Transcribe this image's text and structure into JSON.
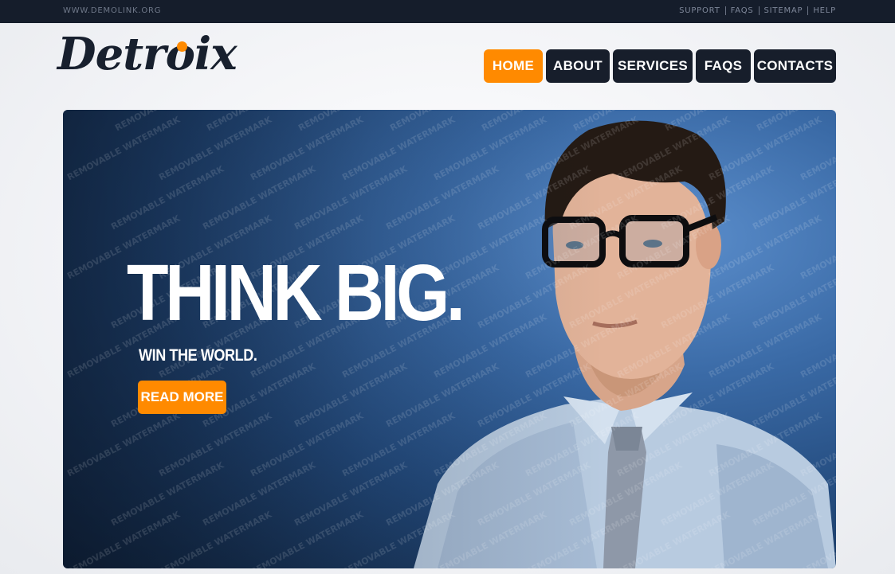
{
  "topbar": {
    "site_url": "WWW.DEMOLINK.ORG",
    "links": [
      "SUPPORT",
      "FAQS",
      "SITEMAP",
      "HELP"
    ]
  },
  "logo": {
    "text": "Detroix"
  },
  "nav": {
    "items": [
      {
        "label": "HOME",
        "active": true
      },
      {
        "label": "ABOUT",
        "active": false
      },
      {
        "label": "SERVICES",
        "active": false
      },
      {
        "label": "FAQS",
        "active": false
      },
      {
        "label": "CONTACTS",
        "active": false
      }
    ]
  },
  "hero": {
    "headline": "THINK BIG.",
    "subheadline": "WIN THE WORLD.",
    "cta_label": "READ MORE",
    "image_subject": "businessman-portrait",
    "watermark": "REMOVABLE WATERMARK"
  },
  "colors": {
    "accent": "#ff8a00",
    "nav_dark": "#171e2b",
    "topbar": "#151d2b",
    "logo": "#18202e"
  }
}
